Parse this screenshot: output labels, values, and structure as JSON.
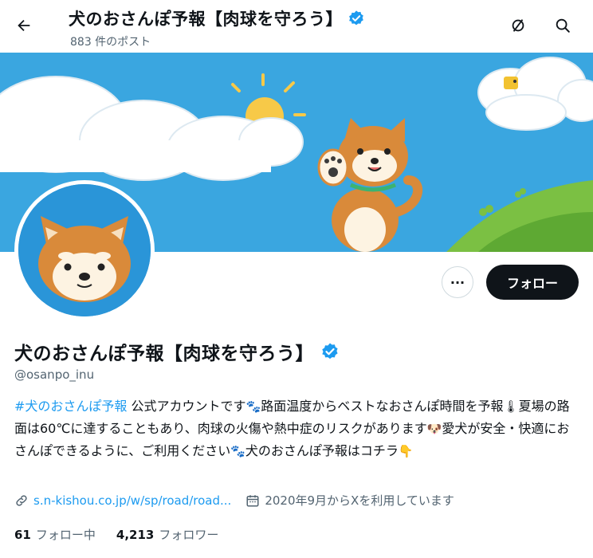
{
  "header": {
    "title": "犬のおさんぽ予報【肉球を守ろう】",
    "post_count": "883 件のポスト",
    "icons": [
      "back-arrow-icon",
      "no-sign-icon",
      "search-icon"
    ]
  },
  "profile": {
    "name": "犬のおさんぽ予報【肉球を守ろう】",
    "handle": "@osanpo_inu",
    "verified": true,
    "bio": {
      "hashtag": "#犬のおさんぽ予報",
      "part1": " 公式アカウントです",
      "part2": "路面温度からベストなおさんぽ時間を予報",
      "part3": "夏場の路面は60℃に達することもあり、肉球の火傷や熱中症のリスクがあります",
      "part4": "愛犬が安全・快適におさんぽできるように、ご利用ください",
      "part5": "犬のおさんぽ予報はコチラ",
      "emoji": {
        "paw": "🐾",
        "thermometer": "🌡",
        "dog_face": "🐶",
        "point_down": "👇"
      }
    },
    "website": "s.n-kishou.co.jp/w/sp/road/road...",
    "joined": "2020年9月からXを利用しています",
    "following_count": "61",
    "following_label": "フォロー中",
    "followers_count": "4,213",
    "followers_label": "フォロワー"
  },
  "actions": {
    "more_label": "···",
    "follow_label": "フォロー"
  },
  "colors": {
    "accent": "#1d9bf0",
    "banner_sky": "#3aa6e0",
    "follow_button": "#0f1419"
  }
}
